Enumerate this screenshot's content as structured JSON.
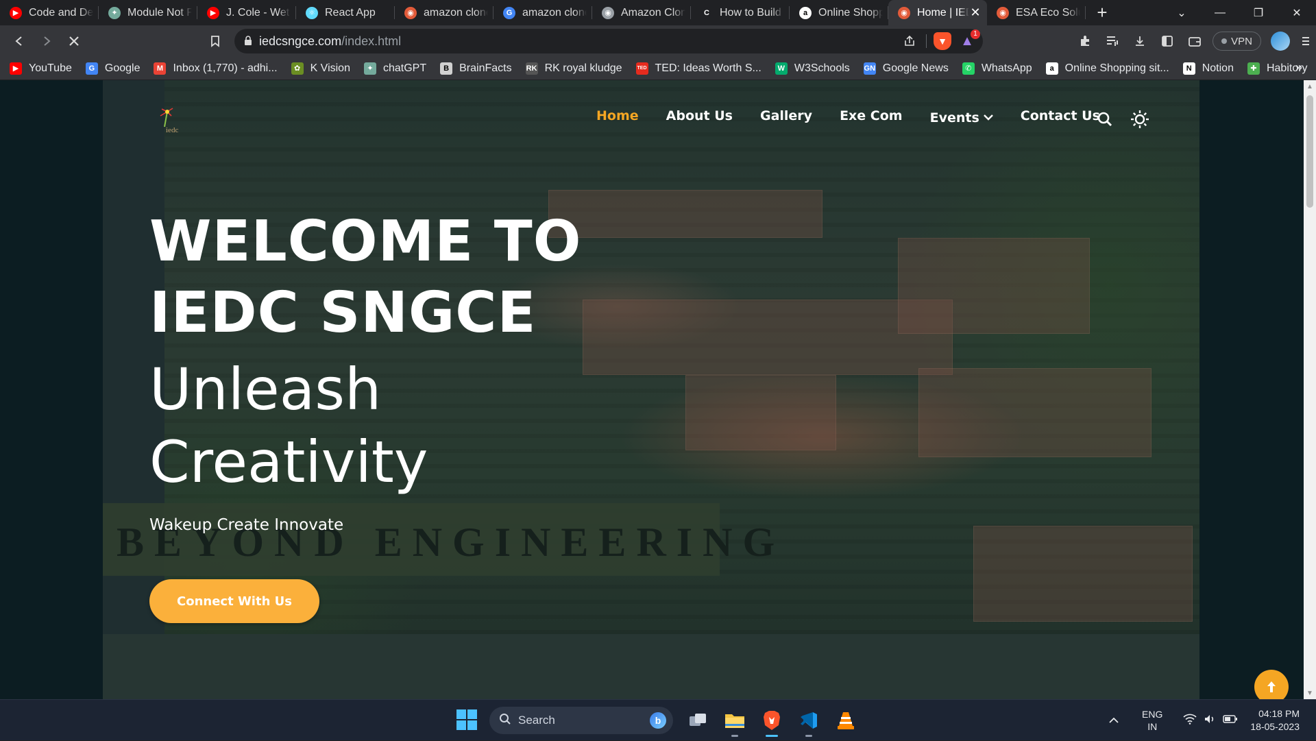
{
  "browser": {
    "tabs": [
      {
        "title": "Code and Depl",
        "favicon": "youtube-icon",
        "color": "#ff0000",
        "active": false
      },
      {
        "title": "Module Not Fo",
        "favicon": "chatgpt-icon",
        "color": "#74aa9c",
        "active": false
      },
      {
        "title": "J. Cole - Wet D",
        "favicon": "youtube-icon",
        "color": "#ff0000",
        "active": false
      },
      {
        "title": "React App",
        "favicon": "react-icon",
        "color": "#61dafb",
        "active": false
      },
      {
        "title": "amazon clone",
        "favicon": "globe-icon",
        "color": "#e25b3a",
        "active": false
      },
      {
        "title": "amazon clone",
        "favicon": "google-icon",
        "color": "#4285f4",
        "active": false
      },
      {
        "title": "Amazon Clone",
        "favicon": "globe-icon",
        "color": "#9aa0a6",
        "active": false
      },
      {
        "title": "How to Build a",
        "favicon": "c-icon",
        "color": "#202124",
        "active": false
      },
      {
        "title": "Online Shoppir",
        "favicon": "amazon-icon",
        "color": "#ffffff",
        "active": false
      },
      {
        "title": "Home | IED",
        "favicon": "iedc-icon",
        "color": "#e25b3a",
        "active": true
      },
      {
        "title": "ESA Eco Soluti",
        "favicon": "esa-icon",
        "color": "#e25b3a",
        "active": false
      }
    ],
    "url_host": "iedcsngce.com",
    "url_path": "/index.html",
    "rewards_badge": "1",
    "vpn_label": "VPN",
    "bookmarks": [
      {
        "label": "YouTube",
        "icon": "youtube-icon",
        "color": "#ff0000"
      },
      {
        "label": "Google",
        "icon": "google-icon",
        "color": "#4285f4"
      },
      {
        "label": "Inbox (1,770) - adhi...",
        "icon": "gmail-icon",
        "color": "#ea4335"
      },
      {
        "label": "K Vision",
        "icon": "kvision-icon",
        "color": "#6b8e23"
      },
      {
        "label": "chatGPT",
        "icon": "chatgpt-icon",
        "color": "#74aa9c"
      },
      {
        "label": "BrainFacts",
        "icon": "brainfacts-icon",
        "color": "#d0d0d0"
      },
      {
        "label": "RK royal kludge",
        "icon": "rk-icon",
        "color": "#555555"
      },
      {
        "label": "TED: Ideas Worth S...",
        "icon": "ted-icon",
        "color": "#e62b1e"
      },
      {
        "label": "W3Schools",
        "icon": "w3schools-icon",
        "color": "#04aa6d"
      },
      {
        "label": "Google News",
        "icon": "google-news-icon",
        "color": "#4285f4"
      },
      {
        "label": "WhatsApp",
        "icon": "whatsapp-icon",
        "color": "#25d366"
      },
      {
        "label": "Online Shopping sit...",
        "icon": "amazon-icon",
        "color": "#ffffff"
      },
      {
        "label": "Notion",
        "icon": "notion-icon",
        "color": "#ffffff"
      },
      {
        "label": "Habitory",
        "icon": "habitory-icon",
        "color": "#4caf50"
      }
    ],
    "bookmarks_more": "»"
  },
  "site": {
    "nav": [
      {
        "label": "Home",
        "active": true
      },
      {
        "label": "About Us",
        "active": false
      },
      {
        "label": "Gallery",
        "active": false
      },
      {
        "label": "Exe Com",
        "active": false
      },
      {
        "label": "Events",
        "active": false,
        "dropdown": true
      },
      {
        "label": "Contact Us",
        "active": false
      }
    ],
    "hero_title_line1": "WELCOME TO",
    "hero_title_line2": "IEDC SNGCE",
    "hero_sub_line1": "Unleash",
    "hero_sub_line2": "Creativity",
    "watermark": "BEYOND ENGINEERING",
    "tagline": "Wakeup Create Innovate",
    "cta_label": "Connect With Us",
    "accent_color": "#f5a623"
  },
  "taskbar": {
    "search_placeholder": "Search",
    "language": "ENG",
    "region": "IN",
    "time": "04:18 PM",
    "date": "18-05-2023"
  }
}
